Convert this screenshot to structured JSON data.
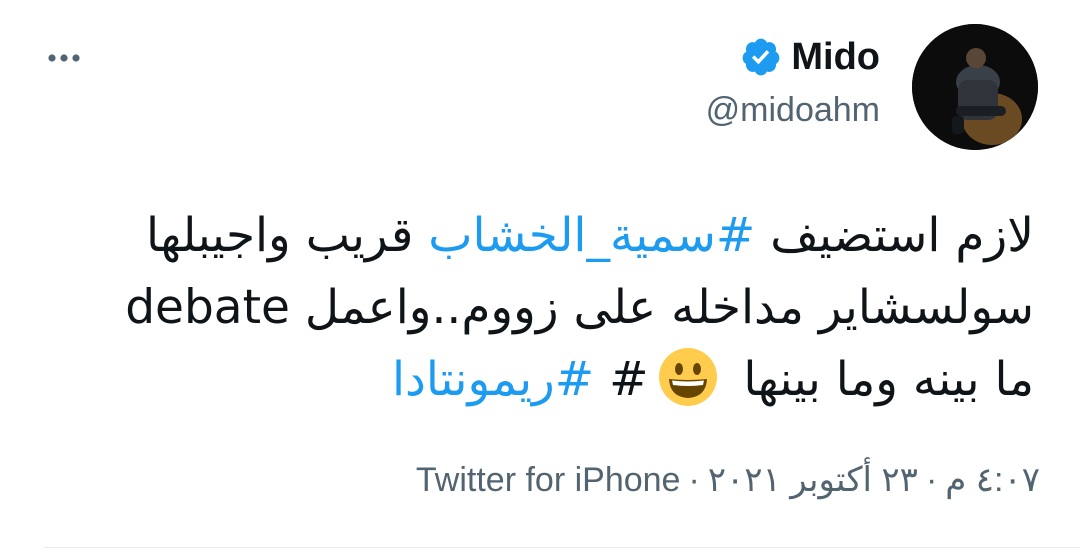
{
  "user": {
    "display_name": "Mido",
    "handle": "@midoahm",
    "verified": true,
    "verified_color": "#1d9bf0"
  },
  "tweet": {
    "lines": [
      {
        "pre": "لازم استضيف ",
        "hashtag": "#سمية_الخشاب",
        "post": " قريب واجيبلها"
      },
      {
        "text": "سولسشاير مداخله على زووم..واعمل debate"
      },
      {
        "pre": "ما بينه وما بينها ",
        "emoji": "grinning-face",
        "hashtag": "#ريمونتادا",
        "hash_sign": "#"
      }
    ],
    "hashtag_color": "#1d9bf0"
  },
  "meta": {
    "time": "٤:٠٧ م",
    "date": "٢٣ أكتوبر ٢٠٢١",
    "separator": "·",
    "source": "Twitter for iPhone"
  },
  "icons": {
    "more": "more-horizontal-icon",
    "verified": "verified-badge-icon"
  }
}
